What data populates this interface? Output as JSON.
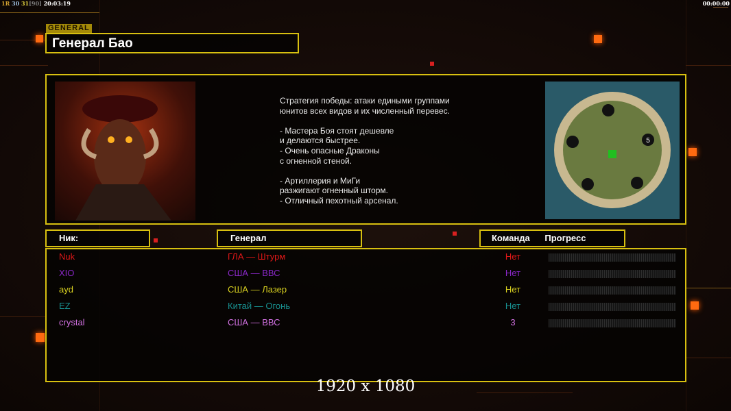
{
  "hud": {
    "left_a": "1R",
    "left_b": "30",
    "left_c": "31",
    "left_d": "[90]",
    "clock": "20:03:19",
    "timer": "00:00:00"
  },
  "header": {
    "tag": "GENERAL",
    "title": "Генерал Бао"
  },
  "description": "Стратегия победы: атаки едиными группами\nюнитов всех видов и их численный перевес.\n\n- Мастера Боя стоят дешевле\nи делаются быстрее.\n- Очень опасные Драконы\nс огненной стеной.\n\n- Артиллерия и МиГи\nразжигают огненный шторм.\n- Отличный пехотный арсенал.",
  "map": {
    "player_marker": "5"
  },
  "table": {
    "headers": {
      "nick": "Ник:",
      "general": "Генерал",
      "team": "Команда",
      "progress": "Прогресс"
    },
    "rows": [
      {
        "nick": "Nuk",
        "general": "ГЛА — Штурм",
        "team": "Нет",
        "color": "#e01818",
        "progress": 0
      },
      {
        "nick": "XIO",
        "general": "США — ВВС",
        "team": "Нет",
        "color": "#8a28c8",
        "progress": 0
      },
      {
        "nick": "ayd",
        "general": "США — Лазер",
        "team": "Нет",
        "color": "#d8d020",
        "progress": 0
      },
      {
        "nick": "EZ",
        "general": "Китай — Огонь",
        "team": "Нет",
        "color": "#189090",
        "progress": 0
      },
      {
        "nick": "crystal",
        "general": "США — ВВС",
        "team": "3",
        "color": "#d070e0",
        "progress": 0
      }
    ]
  },
  "resolution": "1920 x 1080"
}
